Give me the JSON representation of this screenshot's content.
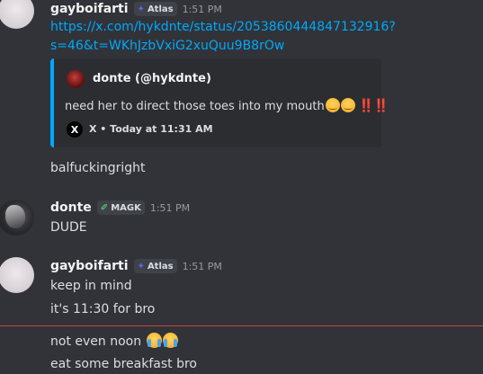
{
  "messages": {
    "m1": {
      "username": "gayboifarti",
      "role_tag": "Atlas",
      "timestamp": "1:51 PM",
      "link_line1": "https://x.com/hykdnte/status/2053860444847132916?",
      "link_line2": "s=46&t=WKhJzbVxiG2xuQuu9B8rOw",
      "embed": {
        "author": "donte (@hykdnte)",
        "text": "need her to direct those toes into my mouth",
        "emphasis": "‼️‼️",
        "footer": "X • Today at 11:31 AM",
        "source_icon": "X"
      },
      "followup": "balfuckingright"
    },
    "m2": {
      "username": "donte",
      "role_tag": "MAGK",
      "timestamp": "1:51 PM",
      "text": "DUDE"
    },
    "m3": {
      "username": "gayboifarti",
      "role_tag": "Atlas",
      "timestamp": "1:51 PM",
      "lines": [
        "keep in mind",
        "it's 11:30 for bro"
      ]
    },
    "new_messages": {
      "line1": "not even noon",
      "line2": "eat some breakfast bro"
    }
  },
  "colors": {
    "background": "#313338",
    "link": "#00a8fc",
    "new_divider": "#c94646",
    "tag_bg": "#404249"
  }
}
